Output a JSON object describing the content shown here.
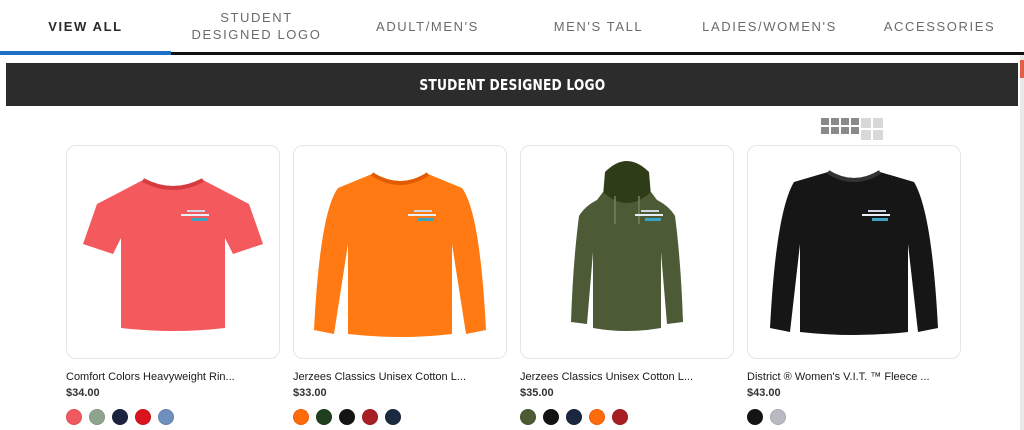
{
  "tabs": [
    {
      "label": "VIEW ALL",
      "active": true
    },
    {
      "label": "STUDENT DESIGNED LOGO",
      "active": false
    },
    {
      "label": "ADULT/MEN'S",
      "active": false
    },
    {
      "label": "MEN'S TALL",
      "active": false
    },
    {
      "label": "LADIES/WOMEN'S",
      "active": false
    },
    {
      "label": "ACCESSORIES",
      "active": false
    }
  ],
  "banner": {
    "title": "STUDENT DESIGNED LOGO"
  },
  "view_options": [
    "four-column-grid-icon",
    "two-column-grid-icon"
  ],
  "products": [
    {
      "name": "Comfort Colors Heavyweight Rin...",
      "price": "$34.00",
      "garment": "tshirt",
      "color": "#f4595d",
      "swatches": [
        "#f0595f",
        "#8fa48e",
        "#1c2340",
        "#d9141e",
        "#6f8fbd"
      ]
    },
    {
      "name": "Jerzees Classics Unisex Cotton L...",
      "price": "$33.00",
      "garment": "longsleeve",
      "color": "#ff7a12",
      "swatches": [
        "#ff6a0b",
        "#1f3f1f",
        "#141414",
        "#a71f24",
        "#1b2a40"
      ]
    },
    {
      "name": "Jerzees Classics Unisex Cotton L...",
      "price": "$35.00",
      "garment": "hoodie",
      "color": "#4c5a35",
      "swatches": [
        "#4d5a33",
        "#141414",
        "#1b2740",
        "#ff6a0b",
        "#a71f24"
      ]
    },
    {
      "name": "District ® Women's V.I.T. ™ Fleece ...",
      "price": "$43.00",
      "garment": "sweatshirt",
      "color": "#161616",
      "swatches": [
        "#141414",
        "#b9b9c2"
      ]
    }
  ]
}
